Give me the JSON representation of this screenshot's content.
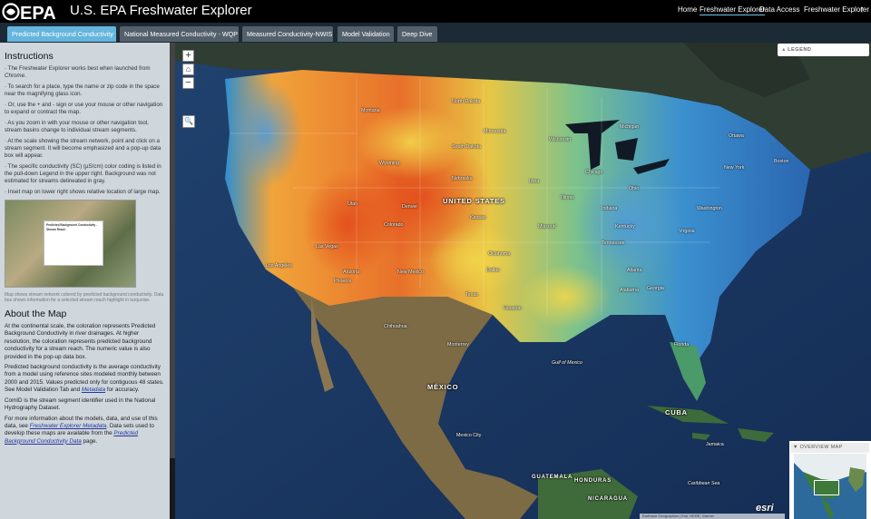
{
  "header": {
    "logo_text": "EPA",
    "title": "U.S. EPA Freshwater Explorer",
    "nav": [
      "Home",
      "Freshwater Explorer",
      "Data Access"
    ],
    "active_nav": "Freshwater Explorer",
    "share_label": "Freshwater Explorer",
    "share_icon": "share-icon"
  },
  "tabs": [
    {
      "label": "Predicted Background Conductivity",
      "active": true
    },
    {
      "label": "National Measured Conductivity - WQP",
      "active": false
    },
    {
      "label": "Measured Conductivity-NWIS",
      "active": false
    },
    {
      "label": "Model Validation",
      "active": false
    },
    {
      "label": "Deep Dive",
      "active": false
    }
  ],
  "panel": {
    "instructions_title": "Instructions",
    "instructions": [
      {
        "pre": "· The Freshwater Explorer works best when launched from ",
        "em": "Chrome",
        "post": "."
      },
      {
        "pre": "· To search for a place, type the name or zip code in the space near the magnifying glass icon.",
        "em": "",
        "post": ""
      },
      {
        "pre": "· Or, use the + and - sign or use your mouse or other navigation to expand or contract the map.",
        "em": "",
        "post": ""
      },
      {
        "pre": "· As you zoom in with your mouse or other navigation tool, stream basins change to individual stream segments.",
        "em": "",
        "post": ""
      },
      {
        "pre": "· At the scale showing the stream network, point and click on a stream segment. It will become emphasized and a pop-up data box will appear.",
        "em": "",
        "post": ""
      },
      {
        "pre": "· The specific conductivity (SC) (µS/cm) color coding is listed in the pull-down Legend in the upper right. Background was not estimated for streams delineated in gray.",
        "em": "",
        "post": ""
      },
      {
        "pre": "· Inset map on lower right shows relative location of large map.",
        "em": "",
        "post": ""
      }
    ],
    "screenshot_popup_title": "Predicted Background Conductivity - Stream Reach",
    "screenshot_caption": "Map shows stream network colored by predicted background conductivity. Data box shows information for a selected stream reach highlight in turquoise.",
    "about_title": "About the Map",
    "about_p1": "At the continental scale, the coloration represents Predicted Background Conductivity in river drainages. At higher resolution, the coloration represents predicted background conductivity for a stream reach. The numeric value is also provided in the pop-up data box.",
    "about_p2_pre": "Predicted background conductivity is the average conductivity from a model using reference sites modeled monthly between 2000 and 2015. Values predicted only for contiguous 48 states. See Model Validation Tab and ",
    "about_p2_link": "Metadata",
    "about_p2_post": " for accuracy.",
    "about_p3": "ComID is the stream segment identifier used in the National Hydrography Dataset.",
    "about_p4_pre": "For more information about the models, data, and use of this data, see ",
    "about_p4_link": "Freshwater Explorer Metadata",
    "about_p4_mid": ". Data sets used to develop these maps are available from the ",
    "about_p4_link2": "Predicted Background Conductivity Data",
    "about_p4_post": " page."
  },
  "map": {
    "zoom_in": "+",
    "home_icon": "home-icon",
    "zoom_out": "−",
    "search_icon": "search-icon",
    "legend_label": "LEGEND",
    "legend_icon": "chevron-up-icon",
    "overview_label": "OVERVIEW MAP",
    "overview_icon": "chevron-down-icon",
    "attribution": "Earthstar Geographics | Esri, HERE, Garmin",
    "esri_logo": "esri",
    "country_labels": [
      {
        "id": "usa",
        "text": "UNITED STATES"
      },
      {
        "id": "mex",
        "text": "MÉXICO"
      },
      {
        "id": "cuba",
        "text": "CUBA"
      },
      {
        "id": "guat",
        "text": "GUATEMALA"
      },
      {
        "id": "hond",
        "text": "HONDURAS"
      },
      {
        "id": "nic",
        "text": "NICARAGUA"
      }
    ],
    "places": [
      {
        "id": "p1",
        "text": "Minnesota"
      },
      {
        "id": "p2",
        "text": "Michigan"
      },
      {
        "id": "p3",
        "text": "Wisconsin"
      },
      {
        "id": "p4",
        "text": "Wyoming"
      },
      {
        "id": "p5",
        "text": "Nebraska"
      },
      {
        "id": "p6",
        "text": "Kansas"
      },
      {
        "id": "p7",
        "text": "Illinois"
      },
      {
        "id": "p8",
        "text": "Ohio"
      },
      {
        "id": "p9",
        "text": "Chicago"
      },
      {
        "id": "p10",
        "text": "Denver"
      },
      {
        "id": "p11",
        "text": "Las Vegas"
      },
      {
        "id": "p12",
        "text": "Arizona"
      },
      {
        "id": "p13",
        "text": "Texas"
      },
      {
        "id": "p14",
        "text": "Dallas"
      },
      {
        "id": "p15",
        "text": "Houston"
      },
      {
        "id": "p16",
        "text": "Atlanta"
      },
      {
        "id": "p17",
        "text": "Florida"
      },
      {
        "id": "p18",
        "text": "New York"
      },
      {
        "id": "p19",
        "text": "Washington"
      },
      {
        "id": "p20",
        "text": "North Dakota"
      },
      {
        "id": "p21",
        "text": "Montana"
      },
      {
        "id": "p22",
        "text": "Utah"
      },
      {
        "id": "p23",
        "text": "Colorado"
      },
      {
        "id": "p24",
        "text": "Missouri"
      },
      {
        "id": "p25",
        "text": "Oklahoma"
      },
      {
        "id": "p26",
        "text": "Tennessee"
      },
      {
        "id": "p27",
        "text": "Georgia"
      },
      {
        "id": "p28",
        "text": "Ottawa"
      },
      {
        "id": "p29",
        "text": "Boston"
      },
      {
        "id": "p30",
        "text": "Mexico City"
      },
      {
        "id": "p31",
        "text": "Monterrey"
      },
      {
        "id": "p32",
        "text": "Chihuahua"
      },
      {
        "id": "p33",
        "text": "Caribbean Sea"
      },
      {
        "id": "p34",
        "text": "Gulf of Mexico"
      },
      {
        "id": "p35",
        "text": "Jamaica"
      },
      {
        "id": "p36",
        "text": "Los Angeles"
      },
      {
        "id": "p37",
        "text": "Phoenix"
      },
      {
        "id": "p38",
        "text": "New Mexico"
      },
      {
        "id": "p39",
        "text": "South Dakota"
      },
      {
        "id": "p40",
        "text": "Iowa"
      },
      {
        "id": "p41",
        "text": "Indiana"
      },
      {
        "id": "p42",
        "text": "Kentucky"
      },
      {
        "id": "p43",
        "text": "Virginia"
      },
      {
        "id": "p44",
        "text": "Alabama"
      }
    ]
  },
  "colors": {
    "accent": "#65b5de",
    "header_bg": "#000000",
    "tabbar_bg": "#1c2a36",
    "panel_bg": "#cfd6dc",
    "low_conductivity": "#2e7fc6",
    "mid_conductivity": "#e8d44a",
    "high_conductivity": "#e25a1c"
  }
}
